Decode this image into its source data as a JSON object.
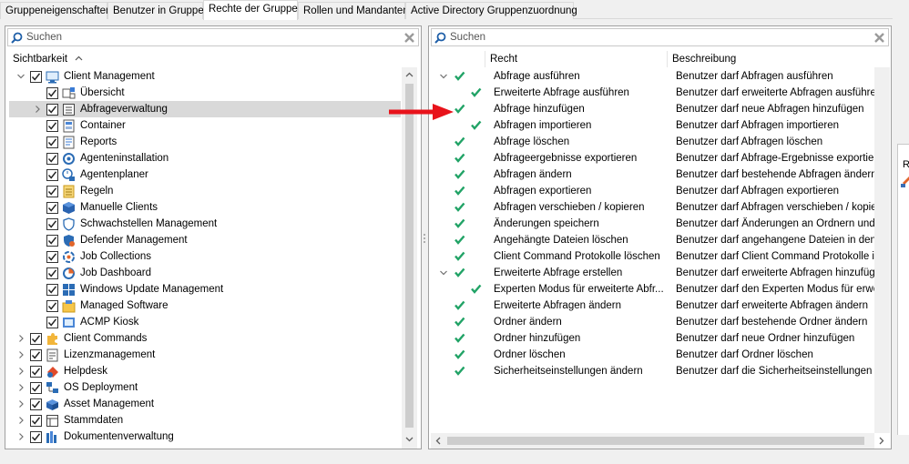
{
  "tabs": [
    {
      "label": "Gruppeneigenschaften"
    },
    {
      "label": "Benutzer in Gruppe"
    },
    {
      "label": "Rechte der Gruppe"
    },
    {
      "label": "Rollen und Mandanten"
    },
    {
      "label": "Active Directory Gruppenzuordnung"
    }
  ],
  "left": {
    "search_placeholder": "Suchen",
    "header": "Sichtbarkeit",
    "items": [
      {
        "label": "Client Management",
        "icon": "monitor-icon"
      },
      {
        "label": "Übersicht",
        "icon": "overview-icon"
      },
      {
        "label": "Abfrageverwaltung",
        "icon": "query-list-icon"
      },
      {
        "label": "Container",
        "icon": "container-icon"
      },
      {
        "label": "Reports",
        "icon": "report-icon"
      },
      {
        "label": "Agenteninstallation",
        "icon": "agent-install-icon"
      },
      {
        "label": "Agentenplaner",
        "icon": "agent-planner-icon"
      },
      {
        "label": "Regeln",
        "icon": "rules-icon"
      },
      {
        "label": "Manuelle Clients",
        "icon": "box-icon"
      },
      {
        "label": "Schwachstellen Management",
        "icon": "shield-icon"
      },
      {
        "label": "Defender Management",
        "icon": "defender-icon"
      },
      {
        "label": "Job Collections",
        "icon": "job-collections-icon"
      },
      {
        "label": "Job Dashboard",
        "icon": "job-dashboard-icon"
      },
      {
        "label": "Windows Update Management",
        "icon": "windows-update-icon"
      },
      {
        "label": "Managed Software",
        "icon": "managed-software-icon"
      },
      {
        "label": "ACMP Kiosk",
        "icon": "kiosk-icon"
      },
      {
        "label": "Client Commands",
        "icon": "puzzle-icon"
      },
      {
        "label": "Lizenzmanagement",
        "icon": "license-icon"
      },
      {
        "label": "Helpdesk",
        "icon": "helpdesk-icon"
      },
      {
        "label": "OS Deployment",
        "icon": "os-deployment-icon"
      },
      {
        "label": "Asset Management",
        "icon": "asset-icon"
      },
      {
        "label": "Stammdaten",
        "icon": "master-data-icon"
      },
      {
        "label": "Dokumentenverwaltung",
        "icon": "documents-icon"
      }
    ]
  },
  "right": {
    "search_placeholder": "Suchen",
    "columns": {
      "right": "Recht",
      "description": "Beschreibung"
    },
    "rows": [
      {
        "right": "Abfrage ausführen",
        "desc": "Benutzer darf Abfragen ausführen"
      },
      {
        "right": "Erweiterte Abfrage ausführen",
        "desc": "Benutzer darf erweiterte Abfragen ausführen"
      },
      {
        "right": "Abfrage hinzufügen",
        "desc": "Benutzer darf neue Abfragen hinzufügen"
      },
      {
        "right": "Abfragen importieren",
        "desc": "Benutzer darf Abfragen importieren"
      },
      {
        "right": "Abfrage löschen",
        "desc": "Benutzer darf Abfragen löschen"
      },
      {
        "right": "Abfrageergebnisse exportieren",
        "desc": "Benutzer darf Abfrage-Ergebnisse exportieren"
      },
      {
        "right": "Abfragen ändern",
        "desc": "Benutzer darf bestehende Abfragen ändern"
      },
      {
        "right": "Abfragen exportieren",
        "desc": "Benutzer darf Abfragen exportieren"
      },
      {
        "right": "Abfragen verschieben / kopieren",
        "desc": "Benutzer darf Abfragen verschieben / kopieren"
      },
      {
        "right": "Änderungen speichern",
        "desc": "Benutzer darf Änderungen an Ordnern und Ab..."
      },
      {
        "right": "Angehängte Dateien löschen",
        "desc": "Benutzer darf angehangene Dateien in den Cli..."
      },
      {
        "right": "Client Command Protokolle löschen",
        "desc": "Benutzer darf Client Command Protokolle in d..."
      },
      {
        "right": "Erweiterte Abfrage erstellen",
        "desc": "Benutzer darf erweiterte Abfragen hinzufügen"
      },
      {
        "right": "Experten Modus für erweiterte Abfr...",
        "desc": "Benutzer darf den Experten Modus für erweite..."
      },
      {
        "right": "Erweiterte Abfragen ändern",
        "desc": "Benutzer darf erweiterte Abfragen ändern"
      },
      {
        "right": "Ordner ändern",
        "desc": "Benutzer darf bestehende Ordner ändern"
      },
      {
        "right": "Ordner hinzufügen",
        "desc": "Benutzer darf neue Ordner hinzufügen"
      },
      {
        "right": "Ordner löschen",
        "desc": "Benutzer darf Ordner löschen"
      },
      {
        "right": "Sicherheitseinstellungen ändern",
        "desc": "Benutzer darf die Sicherheitseinstellungen änd..."
      }
    ]
  },
  "edge_label": "R",
  "colors": {
    "check_green": "#21a366",
    "arrow_red": "#e8131b",
    "selection": "#d9d9d9"
  }
}
